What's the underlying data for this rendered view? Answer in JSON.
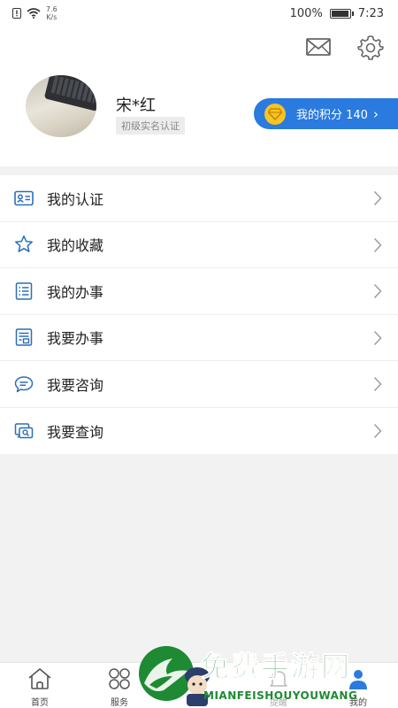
{
  "status_bar": {
    "speed_value": "7.6",
    "speed_unit": "K/s",
    "battery": "100%",
    "battery_level": 1.0,
    "time": "7:23"
  },
  "header": {
    "mail_icon": "envelope-icon",
    "settings_icon": "gear-icon"
  },
  "profile": {
    "name": "宋*红",
    "cert_level": "初级实名认证",
    "points_label": "我的积分 140"
  },
  "menu": {
    "items": [
      {
        "label": "我的认证",
        "icon": "id-card-icon"
      },
      {
        "label": "我的收藏",
        "icon": "star-icon"
      },
      {
        "label": "我的办事",
        "icon": "list-icon"
      },
      {
        "label": "我要办事",
        "icon": "form-icon"
      },
      {
        "label": "我要咨询",
        "icon": "chat-icon"
      },
      {
        "label": "我要查询",
        "icon": "query-icon"
      }
    ]
  },
  "tabbar": {
    "tabs": [
      {
        "label": "首页",
        "icon": "home-icon"
      },
      {
        "label": "服务",
        "icon": "grid-icon"
      },
      {
        "label": "提醒",
        "icon": "bell-icon"
      },
      {
        "label": "我的",
        "icon": "user-icon"
      }
    ]
  },
  "watermark": {
    "title": "免费手游网",
    "subtitle": "MIANFEISHOUYOUWANG"
  },
  "colors": {
    "accent": "#2a7ae0",
    "icon": "#2a6fb8",
    "coin": "#f5c521",
    "watermark": "#1e8a33"
  }
}
